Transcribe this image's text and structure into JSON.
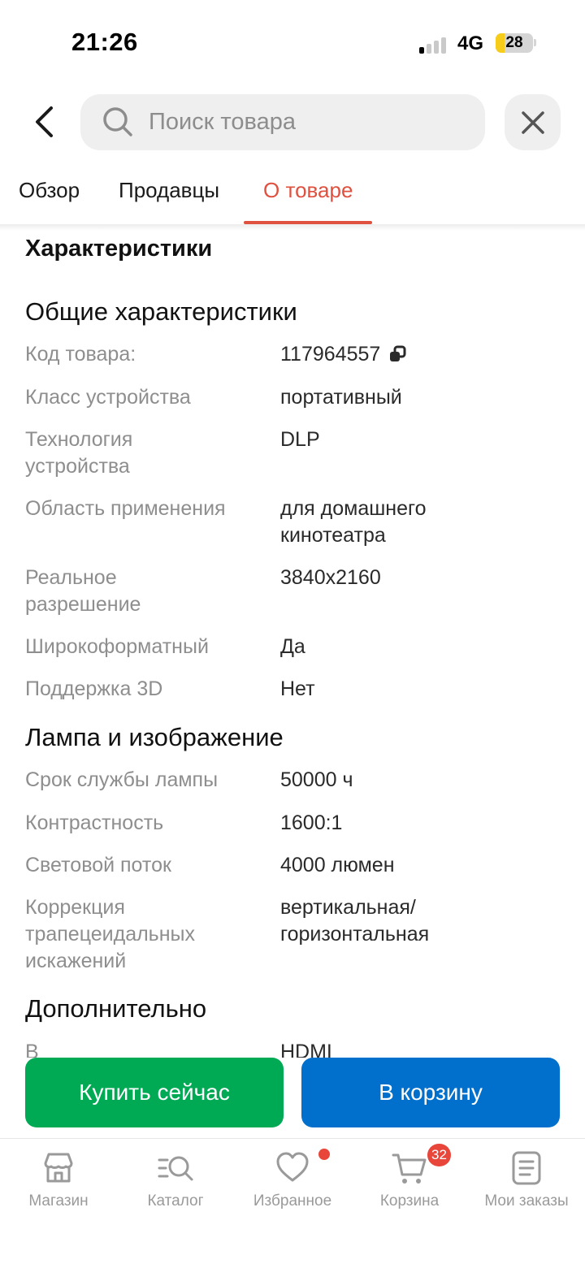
{
  "status_bar": {
    "time": "21:26",
    "network": "4G",
    "battery": "28"
  },
  "header": {
    "search_placeholder": "Поиск товара"
  },
  "tabs": [
    {
      "label": "Обзор",
      "active": false
    },
    {
      "label": "Продавцы",
      "active": false
    },
    {
      "label": "О товаре",
      "active": true
    }
  ],
  "content": {
    "heading": "Характеристики",
    "sections": [
      {
        "title": "Общие характеристики",
        "rows": [
          {
            "label": "Код товара:",
            "value": "117964557"
          },
          {
            "label": "Класс устройства",
            "value": "портативный"
          },
          {
            "label": "Технология устройства",
            "value": "DLP"
          },
          {
            "label": "Область применения",
            "value": "для домашнего кинотеатра"
          },
          {
            "label": "Реальное разрешение",
            "value": "3840x2160"
          },
          {
            "label": "Широкоформатный",
            "value": "Да"
          },
          {
            "label": "Поддержка 3D",
            "value": "Нет"
          }
        ]
      },
      {
        "title": "Лампа и изображение",
        "rows": [
          {
            "label": "Срок службы лампы",
            "value": "50000 ч"
          },
          {
            "label": "Контрастность",
            "value": "1600:1"
          },
          {
            "label": "Световой поток",
            "value": "4000 люмен"
          },
          {
            "label": "Коррекция трапецеидальных искажений",
            "value": "вертикальная/ горизонтальная"
          }
        ]
      },
      {
        "title": "Дополнительно",
        "rows": [
          {
            "label": "В",
            "value": "HDMI"
          }
        ]
      }
    ]
  },
  "actions": {
    "buy_now": "Купить сейчас",
    "add_to_cart": "В корзину"
  },
  "bottom_nav": [
    {
      "label": "Магазин",
      "icon": "store-icon"
    },
    {
      "label": "Каталог",
      "icon": "catalog-search-icon"
    },
    {
      "label": "Избранное",
      "icon": "heart-icon"
    },
    {
      "label": "Корзина",
      "icon": "cart-icon",
      "badge": "32"
    },
    {
      "label": "Мои заказы",
      "icon": "orders-icon"
    }
  ],
  "colors": {
    "accent": "#e0503f",
    "buy": "#00aa55",
    "cart": "#0070cc",
    "badge": "#e8463a"
  }
}
